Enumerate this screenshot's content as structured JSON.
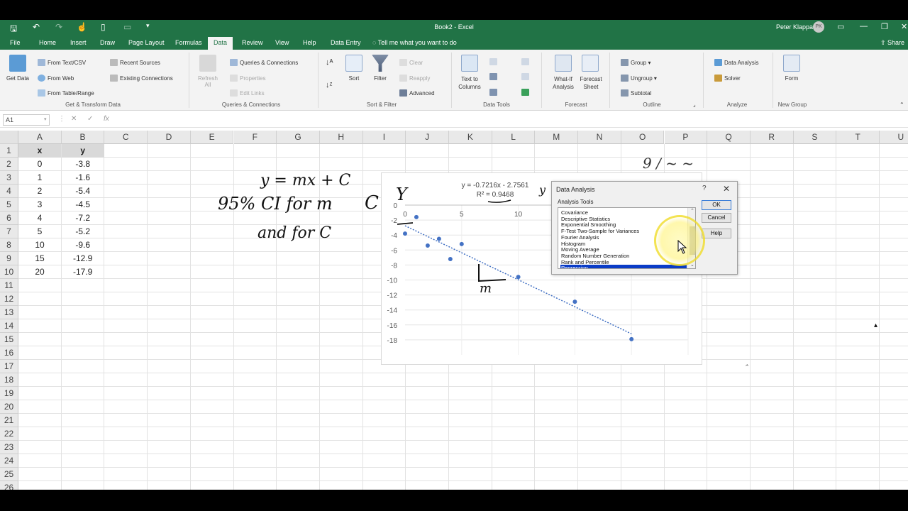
{
  "title_bar": {
    "title": "Book2  -  Excel",
    "user_name": "Peter Klappa",
    "user_initials": "PK"
  },
  "tabs": [
    "File",
    "Home",
    "Insert",
    "Draw",
    "Page Layout",
    "Formulas",
    "Data",
    "Review",
    "View",
    "Help",
    "Data Entry"
  ],
  "active_tab": "Data",
  "tell_me": "Tell me what you want to do",
  "share": "Share",
  "ribbon": {
    "get_transform": {
      "get_data": "Get Data",
      "from_text_csv": "From Text/CSV",
      "from_web": "From Web",
      "from_table_range": "From Table/Range",
      "recent_sources": "Recent Sources",
      "existing_connections": "Existing Connections",
      "group": "Get & Transform Data"
    },
    "queries": {
      "refresh_all": "Refresh All",
      "queries_connections": "Queries & Connections",
      "properties": "Properties",
      "edit_links": "Edit Links",
      "group": "Queries & Connections"
    },
    "sort_filter": {
      "sort": "Sort",
      "filter": "Filter",
      "clear": "Clear",
      "reapply": "Reapply",
      "advanced": "Advanced",
      "group": "Sort & Filter"
    },
    "data_tools": {
      "text_to_columns": "Text to Columns",
      "group": "Data Tools"
    },
    "forecast": {
      "what_if": "What-If Analysis",
      "forecast_sheet": "Forecast Sheet",
      "group": "Forecast"
    },
    "outline": {
      "group_btn": "Group",
      "ungroup": "Ungroup",
      "subtotal": "Subtotal",
      "group": "Outline"
    },
    "analyze": {
      "data_analysis": "Data Analysis",
      "solver": "Solver",
      "group": "Analyze"
    },
    "new_group": {
      "form": "Form",
      "group": "New Group"
    }
  },
  "formula_bar": {
    "name_box": "A1",
    "value": ""
  },
  "columns": [
    "A",
    "B",
    "C",
    "D",
    "E",
    "F",
    "G",
    "H",
    "I",
    "J",
    "K",
    "L",
    "M",
    "N",
    "O",
    "P",
    "Q",
    "R",
    "S",
    "T",
    "U"
  ],
  "rows": [
    "1",
    "2",
    "3",
    "4",
    "5",
    "6",
    "7",
    "8",
    "9",
    "10",
    "11",
    "12",
    "13",
    "14",
    "15",
    "16",
    "17",
    "18",
    "19",
    "20",
    "21",
    "22",
    "23",
    "24",
    "25",
    "26"
  ],
  "table": {
    "headers": [
      "x",
      "y"
    ],
    "rows": [
      [
        "0",
        "-3.8"
      ],
      [
        "1",
        "-1.6"
      ],
      [
        "2",
        "-5.4"
      ],
      [
        "3",
        "-4.5"
      ],
      [
        "4",
        "-7.2"
      ],
      [
        "5",
        "-5.2"
      ],
      [
        "10",
        "-9.6"
      ],
      [
        "15",
        "-12.9"
      ],
      [
        "20",
        "-17.9"
      ]
    ]
  },
  "annotations": {
    "equation": "y = mx + C",
    "ci_line1": "95% CI  for  m",
    "ci_c": "C",
    "ci_line2": "and  for  C",
    "y_label": "Y",
    "m_label": "m",
    "x_label": "x",
    "y_dot": "y",
    "top_right_fragment": "9 / ~ ~"
  },
  "chart_data": {
    "type": "scatter",
    "x": [
      0,
      1,
      2,
      3,
      4,
      5,
      10,
      15,
      20
    ],
    "y": [
      -3.8,
      -1.6,
      -5.4,
      -4.5,
      -7.2,
      -5.2,
      -9.6,
      -12.9,
      -17.9
    ],
    "trendline": {
      "slope": -0.7216,
      "intercept": -2.7561
    },
    "trend_equation": "y = -0.7216x - 2.7561",
    "r_squared": "R² = 0.9468",
    "xlim": [
      0,
      25
    ],
    "ylim": [
      -20,
      0
    ],
    "x_ticks": [
      "0",
      "5",
      "10"
    ],
    "y_ticks": [
      "0",
      "-2",
      "-4",
      "-6",
      "-8",
      "-10",
      "-12",
      "-14",
      "-16",
      "-18"
    ],
    "point_color": "#4472c4",
    "grid": true
  },
  "dialog": {
    "title": "Data Analysis",
    "help_q": "?",
    "close": "✕",
    "label": "Analysis Tools",
    "items": [
      "Covariance",
      "Descriptive Statistics",
      "Exponential Smoothing",
      "F-Test Two-Sample for Variances",
      "Fourier Analysis",
      "Histogram",
      "Moving Average",
      "Random Number Generation",
      "Rank and Percentile",
      "Regression"
    ],
    "selected": "Regression",
    "ok": "OK",
    "cancel": "Cancel",
    "help": "Help"
  },
  "colors": {
    "excel_green": "#217346",
    "selection_blue": "#0a3cc7"
  }
}
